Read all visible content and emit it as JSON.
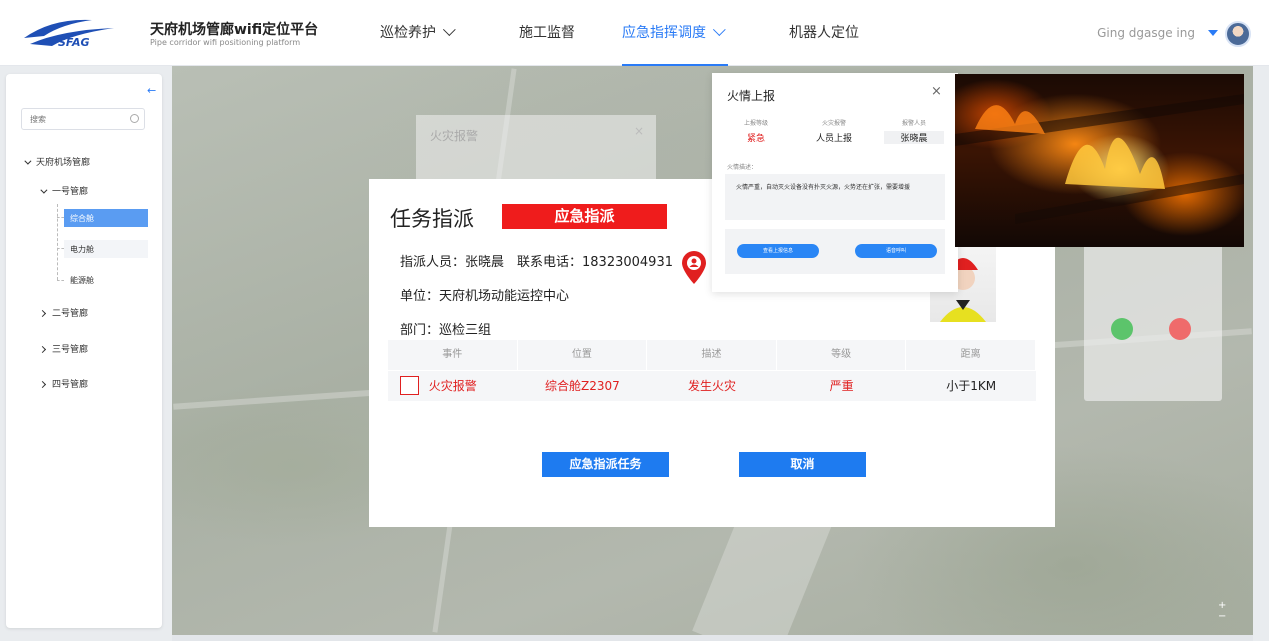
{
  "header": {
    "logo_text": "SFAG",
    "title_cn": "天府机场管廊wifi定位平台",
    "title_en": "Pipe corridor wifi positioning platform",
    "nav": [
      {
        "label": "巡检养护"
      },
      {
        "label": "施工监督"
      },
      {
        "label": "应急指挥调度"
      },
      {
        "label": "机器人定位"
      }
    ],
    "username": "Ging dgasge ing"
  },
  "sidebar": {
    "collapse_glyph": "←",
    "search_placeholder": "搜索",
    "root": "天府机场管廊",
    "group1": "一号管廊",
    "leaves": [
      "综合舱",
      "电力舱",
      "能源舱"
    ],
    "group2": "二号管廊",
    "group3": "三号管廊",
    "group4": "四号管廊"
  },
  "ghost_dialog": {
    "title": "火灾报警",
    "close": "×"
  },
  "task_dialog": {
    "title": "任务指派",
    "badge": "应急指派",
    "assignee_line": "指派人员：张晓晨　联系电话：18323004931",
    "unit_line": "单位：天府机场动能运控中心",
    "dept_line": "部门：巡检三组",
    "table": {
      "headers": [
        "事件",
        "位置",
        "描述",
        "等级",
        "距离"
      ],
      "row": [
        "火灾报警",
        "综合舱Z2307",
        "发生火灾",
        "严重",
        "小于1KM"
      ]
    },
    "confirm_button": "应急指派任务",
    "cancel_button": "取消"
  },
  "fire_report": {
    "title": "火情上报",
    "close": "×",
    "fields": [
      {
        "label": "上报等级",
        "value": "紧急",
        "color": "#e02020"
      },
      {
        "label": "火灾报警",
        "value": "人员上报",
        "color": "#222222"
      },
      {
        "label": "报警人员",
        "value": "张晓晨",
        "color": "#222222"
      }
    ],
    "desc_label": "火情描述：",
    "description": "火情严重，自动灭火设备没有扑灭火源，火势还在扩张，需要增援",
    "btn_view": "查看上报信息",
    "btn_voice": "语音呼叫"
  },
  "colors": {
    "accent": "#2a7bf6",
    "alert_red": "#ef1c1c",
    "button_blue": "#1e7bf0"
  }
}
